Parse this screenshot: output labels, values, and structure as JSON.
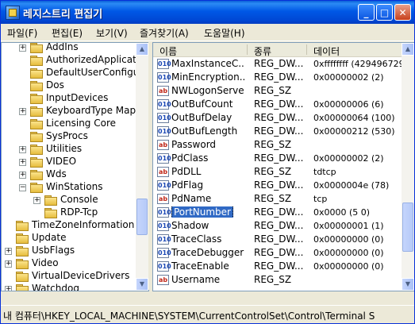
{
  "window": {
    "title": "레지스트리 편집기",
    "min": "_",
    "max": "□",
    "close": "✕"
  },
  "menu": [
    "파일(F)",
    "편집(E)",
    "보기(V)",
    "즐겨찾기(A)",
    "도움말(H)"
  ],
  "tree": {
    "items": [
      {
        "label": "AddIns",
        "expander": "+"
      },
      {
        "label": "AuthorizedApplicatio",
        "expander": ""
      },
      {
        "label": "DefaultUserConfigu",
        "expander": ""
      },
      {
        "label": "Dos",
        "expander": ""
      },
      {
        "label": "InputDevices",
        "expander": ""
      },
      {
        "label": "KeyboardType Map",
        "expander": "+"
      },
      {
        "label": "Licensing Core",
        "expander": ""
      },
      {
        "label": "SysProcs",
        "expander": ""
      },
      {
        "label": "Utilities",
        "expander": "+"
      },
      {
        "label": "VIDEO",
        "expander": "+"
      },
      {
        "label": "Wds",
        "expander": "+"
      },
      {
        "label": "WinStations",
        "expander": "−"
      },
      {
        "label": "Console",
        "expander": "+"
      },
      {
        "label": "RDP-Tcp",
        "expander": ""
      },
      {
        "label": "TimeZoneInformation",
        "expander": ""
      },
      {
        "label": "Update",
        "expander": ""
      },
      {
        "label": "UsbFlags",
        "expander": "+"
      },
      {
        "label": "Video",
        "expander": "+"
      },
      {
        "label": "VirtualDeviceDrivers",
        "expander": ""
      },
      {
        "label": "Watchdog",
        "expander": "+"
      }
    ]
  },
  "list": {
    "headers": {
      "name": "이름",
      "type": "종류",
      "data": "데이터"
    },
    "rows": [
      {
        "kind": "bin",
        "name": "MaxInstanceC...",
        "type": "REG_DW...",
        "data": "0xffffffff (4294967295"
      },
      {
        "kind": "bin",
        "name": "MinEncryption...",
        "type": "REG_DW...",
        "data": "0x00000002 (2)"
      },
      {
        "kind": "sz",
        "name": "NWLogonServer",
        "type": "REG_SZ",
        "data": ""
      },
      {
        "kind": "bin",
        "name": "OutBufCount",
        "type": "REG_DW...",
        "data": "0x00000006 (6)"
      },
      {
        "kind": "bin",
        "name": "OutBufDelay",
        "type": "REG_DW...",
        "data": "0x00000064 (100)"
      },
      {
        "kind": "bin",
        "name": "OutBufLength",
        "type": "REG_DW...",
        "data": "0x00000212 (530)"
      },
      {
        "kind": "sz",
        "name": "Password",
        "type": "REG_SZ",
        "data": ""
      },
      {
        "kind": "bin",
        "name": "PdClass",
        "type": "REG_DW...",
        "data": "0x00000002 (2)"
      },
      {
        "kind": "sz",
        "name": "PdDLL",
        "type": "REG_SZ",
        "data": "tdtcp"
      },
      {
        "kind": "bin",
        "name": "PdFlag",
        "type": "REG_DW...",
        "data": "0x0000004e (78)"
      },
      {
        "kind": "sz",
        "name": "PdName",
        "type": "REG_SZ",
        "data": "tcp"
      },
      {
        "kind": "bin",
        "name": "PortNumber",
        "type": "REG_DW...",
        "data": "0x0000     (5  0)"
      },
      {
        "kind": "bin",
        "name": "Shadow",
        "type": "REG_DW...",
        "data": "0x00000001 (1)"
      },
      {
        "kind": "bin",
        "name": "TraceClass",
        "type": "REG_DW...",
        "data": "0x00000000 (0)"
      },
      {
        "kind": "bin",
        "name": "TraceDebugger",
        "type": "REG_DW...",
        "data": "0x00000000 (0)"
      },
      {
        "kind": "bin",
        "name": "TraceEnable",
        "type": "REG_DW...",
        "data": "0x00000000 (0)"
      },
      {
        "kind": "sz",
        "name": "Username",
        "type": "REG_SZ",
        "data": ""
      }
    ],
    "selected_index": 11
  },
  "status": {
    "path": "내 컴퓨터\\HKEY_LOCAL_MACHINE\\SYSTEM\\CurrentControlSet\\Control\\Terminal S"
  },
  "icons": {
    "binary": "010",
    "string": "ab"
  }
}
